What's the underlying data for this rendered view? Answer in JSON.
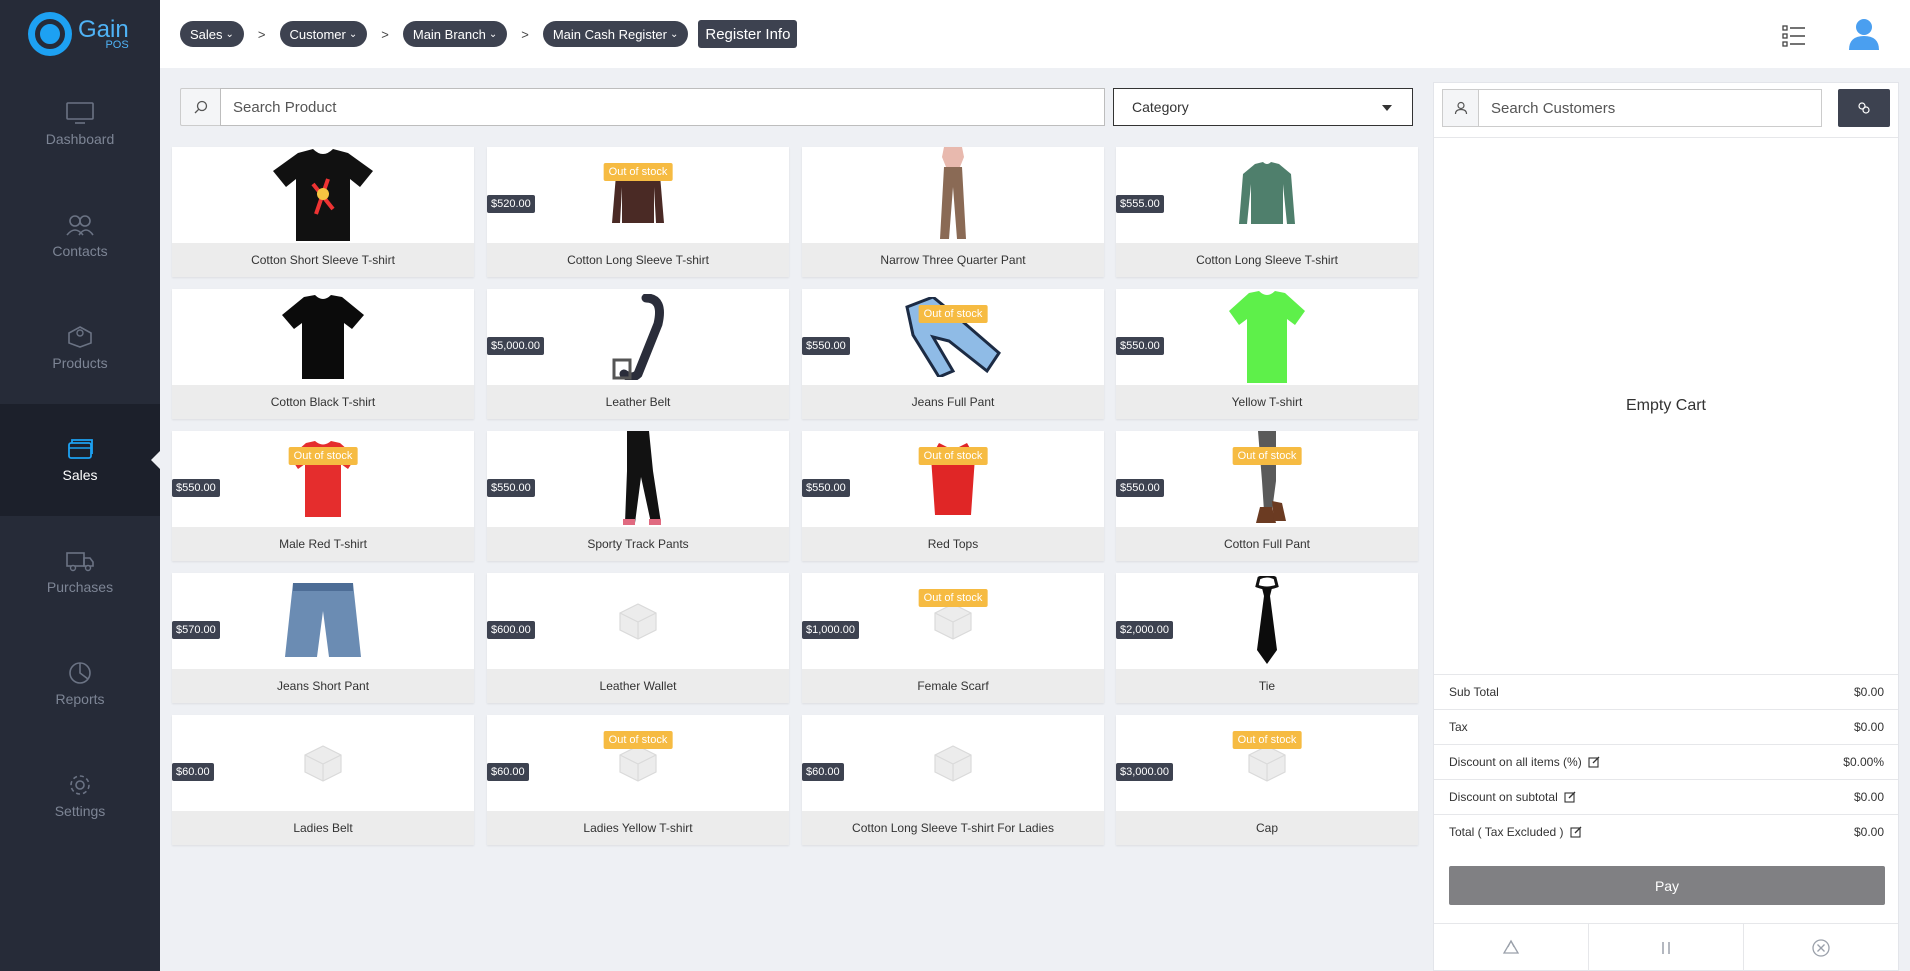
{
  "app": {
    "logo_name": "Gain",
    "logo_sub": "POS"
  },
  "sidebar": {
    "items": [
      {
        "label": "Dashboard",
        "icon": "monitor-icon",
        "active": false
      },
      {
        "label": "Contacts",
        "icon": "users-icon",
        "active": false
      },
      {
        "label": "Products",
        "icon": "products-icon",
        "active": false
      },
      {
        "label": "Sales",
        "icon": "sales-icon",
        "active": true
      },
      {
        "label": "Purchases",
        "icon": "truck-icon",
        "active": false
      },
      {
        "label": "Reports",
        "icon": "pie-chart-icon",
        "active": false
      },
      {
        "label": "Settings",
        "icon": "gear-icon",
        "active": false
      }
    ]
  },
  "breadcrumb": {
    "items": [
      "Sales",
      "Customer",
      "Main Branch",
      "Main Cash Register"
    ],
    "separator": ">",
    "register_info": "Register Info"
  },
  "search": {
    "placeholder": "Search Product",
    "category_label": "Category"
  },
  "products": [
    {
      "name": "Cotton Short Sleeve T-shirt",
      "price": "",
      "out_of_stock": false,
      "image": "black-graphic-tshirt"
    },
    {
      "name": "Cotton Long Sleeve T-shirt",
      "price": "$520.00",
      "out_of_stock": true,
      "image": "brown-longsleeve"
    },
    {
      "name": "Narrow Three Quarter Pant",
      "price": "",
      "out_of_stock": false,
      "image": "tan-pants"
    },
    {
      "name": "Cotton Long Sleeve T-shirt",
      "price": "$555.00",
      "out_of_stock": false,
      "image": "green-sweater"
    },
    {
      "name": "Cotton Black T-shirt",
      "price": "",
      "out_of_stock": false,
      "image": "black-tshirt"
    },
    {
      "name": "Leather Belt",
      "price": "$5,000.00",
      "out_of_stock": false,
      "image": "belt"
    },
    {
      "name": "Jeans Full Pant",
      "price": "$550.00",
      "out_of_stock": true,
      "image": "jeans"
    },
    {
      "name": "Yellow T-shirt",
      "price": "$550.00",
      "out_of_stock": false,
      "image": "green-tshirt"
    },
    {
      "name": "Male Red T-shirt",
      "price": "$550.00",
      "out_of_stock": true,
      "image": "red-tshirt"
    },
    {
      "name": "Sporty Track Pants",
      "price": "$550.00",
      "out_of_stock": false,
      "image": "track-pants"
    },
    {
      "name": "Red Tops",
      "price": "$550.00",
      "out_of_stock": true,
      "image": "red-top"
    },
    {
      "name": "Cotton Full Pant",
      "price": "$550.00",
      "out_of_stock": true,
      "image": "grey-pants"
    },
    {
      "name": "Jeans Short Pant",
      "price": "$570.00",
      "out_of_stock": false,
      "image": "denim-shorts"
    },
    {
      "name": "Leather Wallet",
      "price": "$600.00",
      "out_of_stock": false,
      "image": "placeholder-box"
    },
    {
      "name": "Female Scarf",
      "price": "$1,000.00",
      "out_of_stock": true,
      "image": "placeholder-box"
    },
    {
      "name": "Tie",
      "price": "$2,000.00",
      "out_of_stock": false,
      "image": "tie"
    },
    {
      "name": "Ladies Belt",
      "price": "$60.00",
      "out_of_stock": false,
      "image": "placeholder-box"
    },
    {
      "name": "Ladies Yellow T-shirt",
      "price": "$60.00",
      "out_of_stock": true,
      "image": "placeholder-box"
    },
    {
      "name": "Cotton Long Sleeve T-shirt For Ladies",
      "price": "$60.00",
      "out_of_stock": false,
      "image": "placeholder-box"
    },
    {
      "name": "Cap",
      "price": "$3,000.00",
      "out_of_stock": true,
      "image": "placeholder-box"
    }
  ],
  "out_of_stock_label": "Out of stock",
  "cart": {
    "customer_placeholder": "Search Customers",
    "empty_label": "Empty Cart",
    "totals": [
      {
        "label": "Sub Total",
        "value": "$0.00",
        "editable": false
      },
      {
        "label": "Tax",
        "value": "$0.00",
        "editable": false
      },
      {
        "label": "Discount on all items (%)",
        "value": "$0.00%",
        "editable": true
      },
      {
        "label": "Discount on subtotal",
        "value": "$0.00",
        "editable": true
      },
      {
        "label": "Total ( Tax Excluded )",
        "value": "$0.00",
        "editable": true
      }
    ],
    "pay_label": "Pay"
  },
  "colors": {
    "accent": "#1da1f2",
    "sidebar": "#262b38",
    "badge": "#3d4250",
    "out_of_stock": "#f6bb42",
    "pay_button": "#808083"
  }
}
